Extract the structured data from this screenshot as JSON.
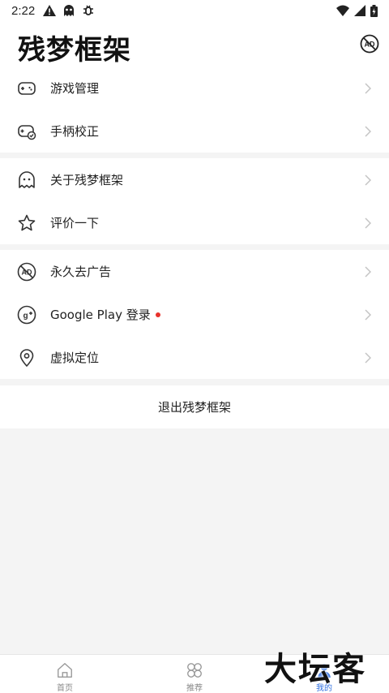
{
  "status_bar": {
    "time": "2:22",
    "icons": [
      "warning-icon",
      "ghost-icon",
      "debug-icon"
    ],
    "right_icons": [
      "wifi-icon",
      "cellular-icon",
      "battery-icon"
    ]
  },
  "header": {
    "title": "残梦框架",
    "no_ad_icon": "no-ad-icon"
  },
  "groups": [
    {
      "items": [
        {
          "label": "游戏管理",
          "icon": "gamepad-icon"
        },
        {
          "label": "手柄校正",
          "icon": "gamepad-check-icon"
        }
      ]
    },
    {
      "items": [
        {
          "label": "关于残梦框架",
          "icon": "ghost-icon"
        },
        {
          "label": "评价一下",
          "icon": "star-icon"
        }
      ]
    },
    {
      "items": [
        {
          "label": "永久去广告",
          "icon": "no-ad-icon"
        },
        {
          "label": "Google Play 登录",
          "icon": "google-plus-icon",
          "badge": "red-dot"
        },
        {
          "label": "虚拟定位",
          "icon": "location-pin-icon"
        }
      ]
    }
  ],
  "logout_label": "退出残梦框架",
  "tabbar": {
    "tabs": [
      {
        "label": "首页",
        "icon": "home-icon",
        "active": false
      },
      {
        "label": "推荐",
        "icon": "clover-icon",
        "active": false
      },
      {
        "label": "我的",
        "icon": "person-icon",
        "active": true
      }
    ]
  },
  "watermark": "大坛客",
  "colors": {
    "accent": "#2f6fe0",
    "badge": "#e8322c",
    "background": "#f4f4f4"
  }
}
